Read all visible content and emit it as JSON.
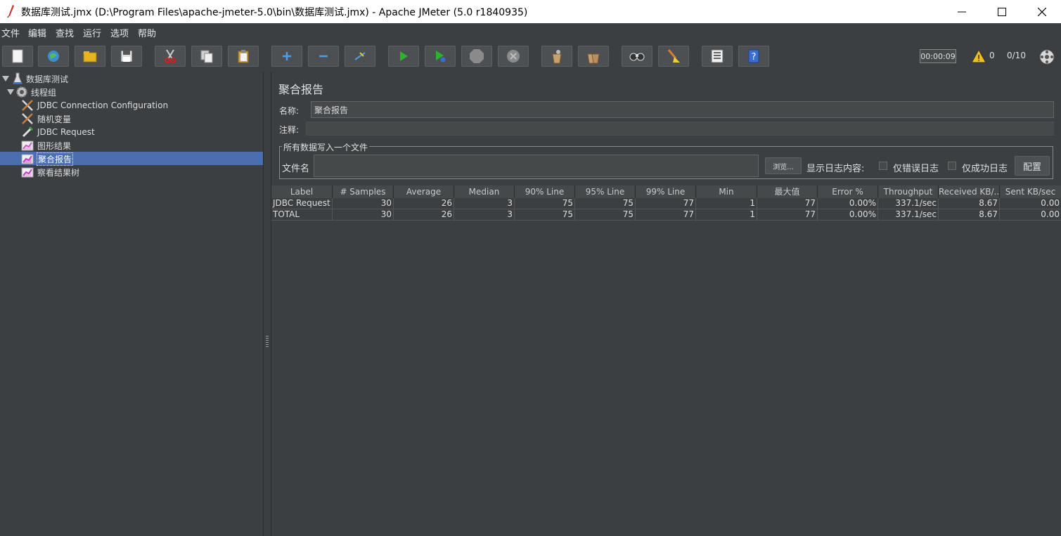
{
  "window": {
    "title": "数据库测试.jmx (D:\\Program Files\\apache-jmeter-5.0\\bin\\数据库测试.jmx) - Apache JMeter (5.0 r1840935)",
    "minimize_icon": "minimize-icon",
    "maximize_icon": "maximize-icon",
    "close_icon": "close-icon"
  },
  "menu": [
    "文件",
    "编辑",
    "查找",
    "运行",
    "选项",
    "帮助"
  ],
  "toolbar": {
    "buttons": [
      "new-icon",
      "templates-icon",
      "open-icon",
      "save-icon",
      "cut-icon",
      "copy-icon",
      "paste-icon",
      "expand-icon",
      "collapse-icon",
      "toggle-icon",
      "start-icon",
      "start-no-pause-icon",
      "stop-icon",
      "shutdown-icon",
      "clear-icon",
      "clear-all-icon",
      "search-icon",
      "reset-search-icon",
      "function-helper-icon",
      "help-icon"
    ],
    "timer": "00:00:09",
    "warning_count": "0",
    "threads": "0/10"
  },
  "tree": {
    "items": [
      {
        "label": "数据库测试",
        "icon": "test-plan-icon"
      },
      {
        "label": "线程组",
        "icon": "thread-group-icon"
      },
      {
        "label": "JDBC Connection Configuration",
        "icon": "config-element-icon"
      },
      {
        "label": "随机变量",
        "icon": "config-element-icon"
      },
      {
        "label": "JDBC Request",
        "icon": "sampler-icon"
      },
      {
        "label": "图形结果",
        "icon": "listener-icon"
      },
      {
        "label": "聚合报告",
        "icon": "listener-icon",
        "selected": true
      },
      {
        "label": "察看结果树",
        "icon": "listener-icon"
      }
    ]
  },
  "panel": {
    "title": "聚合报告",
    "name_label": "名称:",
    "name_value": "聚合报告",
    "comment_label": "注释:",
    "comment_value": "",
    "file_group_title": "所有数据写入一个文件",
    "file_label": "文件名",
    "file_value": "",
    "browse_button": "浏览...",
    "log_content_label": "显示日志内容:",
    "errors_only_label": "仅错误日志",
    "success_only_label": "仅成功日志",
    "configure_button": "配置"
  },
  "table": {
    "headers": [
      "Label",
      "# Samples",
      "Average",
      "Median",
      "90% Line",
      "95% Line",
      "99% Line",
      "Min",
      "最大值",
      "Error %",
      "Throughput",
      "Received KB/...",
      "Sent KB/sec"
    ],
    "rows": [
      [
        "JDBC Request",
        "30",
        "26",
        "3",
        "75",
        "75",
        "77",
        "1",
        "77",
        "0.00%",
        "337.1/sec",
        "8.67",
        "0.00"
      ],
      [
        "TOTAL",
        "30",
        "26",
        "3",
        "75",
        "75",
        "77",
        "1",
        "77",
        "0.00%",
        "337.1/sec",
        "8.67",
        "0.00"
      ]
    ]
  }
}
